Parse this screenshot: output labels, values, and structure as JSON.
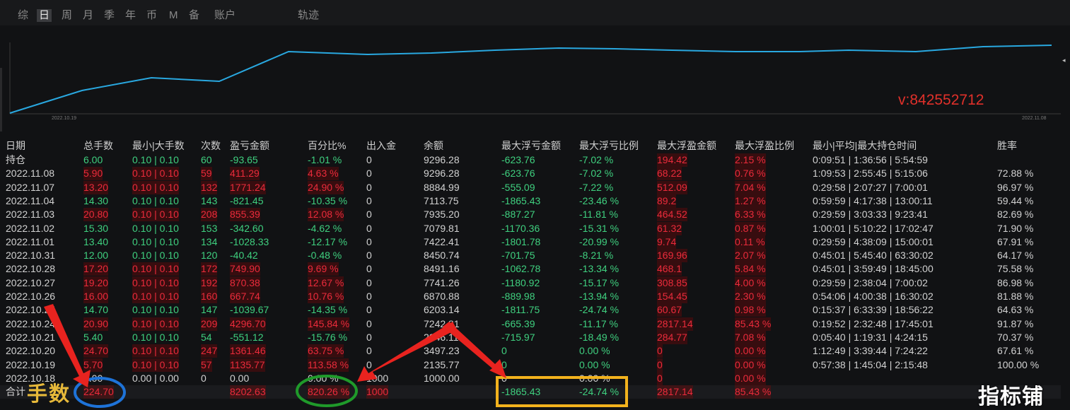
{
  "tabs": [
    {
      "label": "综",
      "active": false
    },
    {
      "label": "日",
      "active": true
    },
    {
      "label": "周",
      "active": false
    },
    {
      "label": "月",
      "active": false
    },
    {
      "label": "季",
      "active": false
    },
    {
      "label": "年",
      "active": false
    },
    {
      "label": "币",
      "active": false
    },
    {
      "label": "M",
      "active": false
    },
    {
      "label": "备",
      "active": false
    },
    {
      "label": "账户",
      "active": false
    },
    {
      "label": "轨迹",
      "active": false
    }
  ],
  "chart": {
    "start_date": "2022.10.19",
    "end_date": "2022.11.08",
    "watermark": "v:842552712",
    "line_color": "#29a8e0"
  },
  "table": {
    "headers": [
      "日期",
      "总手数",
      "最小|大手数",
      "次数",
      "盈亏金额",
      "百分比%",
      "出入金",
      "余额",
      "最大浮亏金额",
      "最大浮亏比例",
      "最大浮盈金额",
      "最大浮盈比例",
      "最小|平均|最大持仓时间",
      "胜率"
    ],
    "rows": [
      {
        "date": "持仓",
        "lots": "6.00",
        "minmax": "0.10 | 0.10",
        "count": "60",
        "pl": "-93.65",
        "pct": "-1.01 %",
        "flow": "0",
        "balance": "9296.28",
        "maxloss": "-623.76",
        "maxloss_pct": "-7.02 %",
        "maxprofit": "194.42",
        "maxprofit_pct": "2.15 %",
        "time": "0:09:51 | 1:36:56 | 5:54:59",
        "win": "",
        "sign": "loss"
      },
      {
        "date": "2022.11.08",
        "lots": "5.90",
        "minmax": "0.10 | 0.10",
        "count": "59",
        "pl": "411.29",
        "pct": "4.63 %",
        "flow": "0",
        "balance": "9296.28",
        "maxloss": "-623.76",
        "maxloss_pct": "-7.02 %",
        "maxprofit": "68.22",
        "maxprofit_pct": "0.76 %",
        "time": "1:09:53 | 2:55:45 | 5:15:06",
        "win": "72.88 %",
        "sign": "profit"
      },
      {
        "date": "2022.11.07",
        "lots": "13.20",
        "minmax": "0.10 | 0.10",
        "count": "132",
        "pl": "1771.24",
        "pct": "24.90 %",
        "flow": "0",
        "balance": "8884.99",
        "maxloss": "-555.09",
        "maxloss_pct": "-7.22 %",
        "maxprofit": "512.09",
        "maxprofit_pct": "7.04 %",
        "time": "0:29:58 | 2:07:27 | 7:00:01",
        "win": "96.97 %",
        "sign": "profit"
      },
      {
        "date": "2022.11.04",
        "lots": "14.30",
        "minmax": "0.10 | 0.10",
        "count": "143",
        "pl": "-821.45",
        "pct": "-10.35 %",
        "flow": "0",
        "balance": "7113.75",
        "maxloss": "-1865.43",
        "maxloss_pct": "-23.46 %",
        "maxprofit": "89.2",
        "maxprofit_pct": "1.27 %",
        "time": "0:59:59 | 4:17:38 | 13:00:11",
        "win": "59.44 %",
        "sign": "loss"
      },
      {
        "date": "2022.11.03",
        "lots": "20.80",
        "minmax": "0.10 | 0.10",
        "count": "208",
        "pl": "855.39",
        "pct": "12.08 %",
        "flow": "0",
        "balance": "7935.20",
        "maxloss": "-887.27",
        "maxloss_pct": "-11.81 %",
        "maxprofit": "464.52",
        "maxprofit_pct": "6.33 %",
        "time": "0:29:59 | 3:03:33 | 9:23:41",
        "win": "82.69 %",
        "sign": "profit"
      },
      {
        "date": "2022.11.02",
        "lots": "15.30",
        "minmax": "0.10 | 0.10",
        "count": "153",
        "pl": "-342.60",
        "pct": "-4.62 %",
        "flow": "0",
        "balance": "7079.81",
        "maxloss": "-1170.36",
        "maxloss_pct": "-15.31 %",
        "maxprofit": "61.32",
        "maxprofit_pct": "0.87 %",
        "time": "1:00:01 | 5:10:22 | 17:02:47",
        "win": "71.90 %",
        "sign": "loss"
      },
      {
        "date": "2022.11.01",
        "lots": "13.40",
        "minmax": "0.10 | 0.10",
        "count": "134",
        "pl": "-1028.33",
        "pct": "-12.17 %",
        "flow": "0",
        "balance": "7422.41",
        "maxloss": "-1801.78",
        "maxloss_pct": "-20.99 %",
        "maxprofit": "9.74",
        "maxprofit_pct": "0.11 %",
        "time": "0:29:59 | 4:38:09 | 15:00:01",
        "win": "67.91 %",
        "sign": "loss"
      },
      {
        "date": "2022.10.31",
        "lots": "12.00",
        "minmax": "0.10 | 0.10",
        "count": "120",
        "pl": "-40.42",
        "pct": "-0.48 %",
        "flow": "0",
        "balance": "8450.74",
        "maxloss": "-701.75",
        "maxloss_pct": "-8.21 %",
        "maxprofit": "169.96",
        "maxprofit_pct": "2.07 %",
        "time": "0:45:01 | 5:45:40 | 63:30:02",
        "win": "64.17 %",
        "sign": "loss"
      },
      {
        "date": "2022.10.28",
        "lots": "17.20",
        "minmax": "0.10 | 0.10",
        "count": "172",
        "pl": "749.90",
        "pct": "9.69 %",
        "flow": "0",
        "balance": "8491.16",
        "maxloss": "-1062.78",
        "maxloss_pct": "-13.34 %",
        "maxprofit": "468.1",
        "maxprofit_pct": "5.84 %",
        "time": "0:45:01 | 3:59:49 | 18:45:00",
        "win": "75.58 %",
        "sign": "profit"
      },
      {
        "date": "2022.10.27",
        "lots": "19.20",
        "minmax": "0.10 | 0.10",
        "count": "192",
        "pl": "870.38",
        "pct": "12.67 %",
        "flow": "0",
        "balance": "7741.26",
        "maxloss": "-1180.92",
        "maxloss_pct": "-15.17 %",
        "maxprofit": "308.85",
        "maxprofit_pct": "4.00 %",
        "time": "0:29:59 | 2:38:04 | 7:00:02",
        "win": "86.98 %",
        "sign": "profit"
      },
      {
        "date": "2022.10.26",
        "lots": "16.00",
        "minmax": "0.10 | 0.10",
        "count": "160",
        "pl": "667.74",
        "pct": "10.76 %",
        "flow": "0",
        "balance": "6870.88",
        "maxloss": "-889.98",
        "maxloss_pct": "-13.94 %",
        "maxprofit": "154.45",
        "maxprofit_pct": "2.30 %",
        "time": "0:54:06 | 4:00:38 | 16:30:02",
        "win": "81.88 %",
        "sign": "profit"
      },
      {
        "date": "2022.10.25",
        "lots": "14.70",
        "minmax": "0.10 | 0.10",
        "count": "147",
        "pl": "-1039.67",
        "pct": "-14.35 %",
        "flow": "0",
        "balance": "6203.14",
        "maxloss": "-1811.75",
        "maxloss_pct": "-24.74 %",
        "maxprofit": "60.67",
        "maxprofit_pct": "0.98 %",
        "time": "0:15:37 | 6:33:39 | 18:56:22",
        "win": "64.63 %",
        "sign": "loss"
      },
      {
        "date": "2022.10.24",
        "lots": "20.90",
        "minmax": "0.10 | 0.10",
        "count": "209",
        "pl": "4296.70",
        "pct": "145.84 %",
        "flow": "0",
        "balance": "7242.81",
        "maxloss": "-665.39",
        "maxloss_pct": "-11.17 %",
        "maxprofit": "2817.14",
        "maxprofit_pct": "85.43 %",
        "time": "0:19:52 | 2:32:48 | 17:45:01",
        "win": "91.87 %",
        "sign": "profit"
      },
      {
        "date": "2022.10.21",
        "lots": "5.40",
        "minmax": "0.10 | 0.10",
        "count": "54",
        "pl": "-551.12",
        "pct": "-15.76 %",
        "flow": "0",
        "balance": "2946.11",
        "maxloss": "-715.97",
        "maxloss_pct": "-18.49 %",
        "maxprofit": "284.77",
        "maxprofit_pct": "7.08 %",
        "time": "0:05:40 | 1:19:31 | 4:24:15",
        "win": "70.37 %",
        "sign": "loss"
      },
      {
        "date": "2022.10.20",
        "lots": "24.70",
        "minmax": "0.10 | 0.10",
        "count": "247",
        "pl": "1361.46",
        "pct": "63.75 %",
        "flow": "0",
        "balance": "3497.23",
        "maxloss": "0",
        "maxloss_pct": "0.00 %",
        "maxprofit": "0",
        "maxprofit_pct": "0.00 %",
        "time": "1:12:49 | 3:39:44 | 7:24:22",
        "win": "67.61 %",
        "sign": "profit"
      },
      {
        "date": "2022.10.19",
        "lots": "5.70",
        "minmax": "0.10 | 0.10",
        "count": "57",
        "pl": "1135.77",
        "pct": "113.58 %",
        "flow": "0",
        "balance": "2135.77",
        "maxloss": "0",
        "maxloss_pct": "0.00 %",
        "maxprofit": "0",
        "maxprofit_pct": "0.00 %",
        "time": "0:57:38 | 1:45:04 | 2:15:48",
        "win": "100.00 %",
        "sign": "profit"
      },
      {
        "date": "2022.10.18",
        "lots": "0.00",
        "minmax": "0.00 | 0.00",
        "count": "0",
        "pl": "0.00",
        "pct": "0.00 %",
        "flow": "1000",
        "balance": "1000.00",
        "maxloss": "0",
        "maxloss_pct": "0.00 %",
        "maxprofit": "0",
        "maxprofit_pct": "0.00 %",
        "time": "",
        "win": "",
        "sign": "neutral"
      }
    ],
    "total": {
      "date": "合计",
      "lots": "224.70",
      "pl": "8202.63",
      "pct": "820.26 %",
      "flow": "1000",
      "maxloss": "-1865.43",
      "maxloss_pct": "-24.74 %",
      "maxprofit": "2817.14",
      "maxprofit_pct": "85.43 %"
    }
  },
  "annotations": {
    "lots_label": "手数",
    "logo": "指标铺",
    "arrow_color": "#e8231f",
    "circle_blue": "#1e73d8",
    "circle_green": "#1f9a2a",
    "box_yellow": "#f2b21d"
  }
}
